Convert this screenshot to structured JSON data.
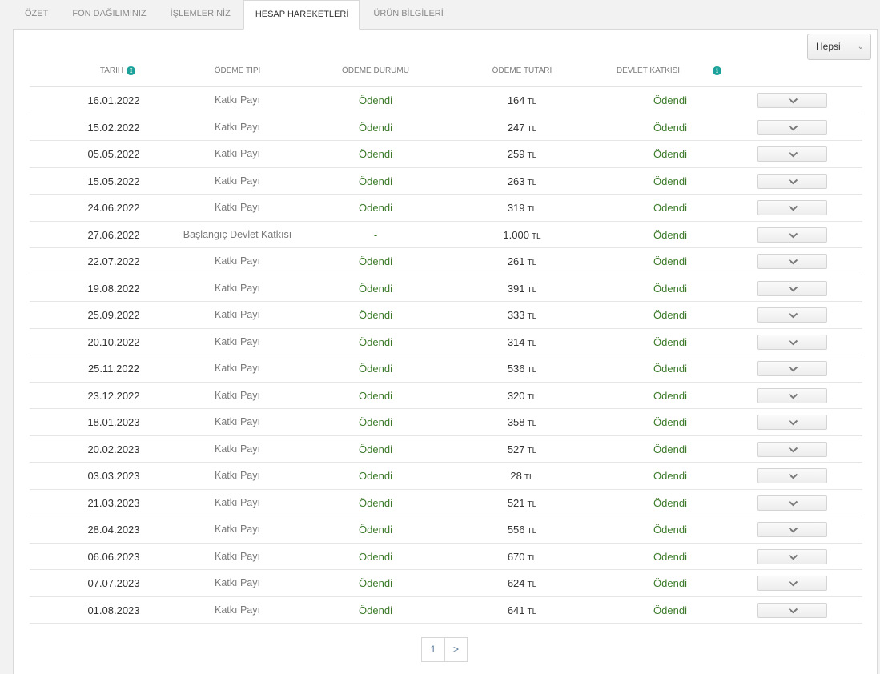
{
  "tabs": [
    {
      "label": "ÖZET"
    },
    {
      "label": "FON DAĞILIMINIZ"
    },
    {
      "label": "İŞLEMLERİNİZ"
    },
    {
      "label": "HESAP HAREKETLERİ",
      "active": true
    },
    {
      "label": "ÜRÜN BİLGİLERİ"
    }
  ],
  "filter": {
    "value": "Hepsi"
  },
  "columns": {
    "date": "TARİH",
    "type": "ÖDEME TİPİ",
    "status": "ÖDEME DURUMU",
    "amount": "ÖDEME TUTARI",
    "gov": "DEVLET KATKISI"
  },
  "currency": "TL",
  "rows": [
    {
      "date": "16.01.2022",
      "type": "Katkı Payı",
      "status": "Ödendi",
      "amount": "164",
      "gov": "Ödendi"
    },
    {
      "date": "15.02.2022",
      "type": "Katkı Payı",
      "status": "Ödendi",
      "amount": "247",
      "gov": "Ödendi"
    },
    {
      "date": "05.05.2022",
      "type": "Katkı Payı",
      "status": "Ödendi",
      "amount": "259",
      "gov": "Ödendi"
    },
    {
      "date": "15.05.2022",
      "type": "Katkı Payı",
      "status": "Ödendi",
      "amount": "263",
      "gov": "Ödendi"
    },
    {
      "date": "24.06.2022",
      "type": "Katkı Payı",
      "status": "Ödendi",
      "amount": "319",
      "gov": "Ödendi"
    },
    {
      "date": "27.06.2022",
      "type": "Başlangıç Devlet Katkısı",
      "status": "-",
      "amount": "1.000",
      "gov": "Ödendi"
    },
    {
      "date": "22.07.2022",
      "type": "Katkı Payı",
      "status": "Ödendi",
      "amount": "261",
      "gov": "Ödendi"
    },
    {
      "date": "19.08.2022",
      "type": "Katkı Payı",
      "status": "Ödendi",
      "amount": "391",
      "gov": "Ödendi"
    },
    {
      "date": "25.09.2022",
      "type": "Katkı Payı",
      "status": "Ödendi",
      "amount": "333",
      "gov": "Ödendi"
    },
    {
      "date": "20.10.2022",
      "type": "Katkı Payı",
      "status": "Ödendi",
      "amount": "314",
      "gov": "Ödendi"
    },
    {
      "date": "25.11.2022",
      "type": "Katkı Payı",
      "status": "Ödendi",
      "amount": "536",
      "gov": "Ödendi"
    },
    {
      "date": "23.12.2022",
      "type": "Katkı Payı",
      "status": "Ödendi",
      "amount": "320",
      "gov": "Ödendi"
    },
    {
      "date": "18.01.2023",
      "type": "Katkı Payı",
      "status": "Ödendi",
      "amount": "358",
      "gov": "Ödendi"
    },
    {
      "date": "20.02.2023",
      "type": "Katkı Payı",
      "status": "Ödendi",
      "amount": "527",
      "gov": "Ödendi"
    },
    {
      "date": "03.03.2023",
      "type": "Katkı Payı",
      "status": "Ödendi",
      "amount": "28",
      "gov": "Ödendi"
    },
    {
      "date": "21.03.2023",
      "type": "Katkı Payı",
      "status": "Ödendi",
      "amount": "521",
      "gov": "Ödendi"
    },
    {
      "date": "28.04.2023",
      "type": "Katkı Payı",
      "status": "Ödendi",
      "amount": "556",
      "gov": "Ödendi"
    },
    {
      "date": "06.06.2023",
      "type": "Katkı Payı",
      "status": "Ödendi",
      "amount": "670",
      "gov": "Ödendi"
    },
    {
      "date": "07.07.2023",
      "type": "Katkı Payı",
      "status": "Ödendi",
      "amount": "624",
      "gov": "Ödendi"
    },
    {
      "date": "01.08.2023",
      "type": "Katkı Payı",
      "status": "Ödendi",
      "amount": "641",
      "gov": "Ödendi"
    }
  ],
  "pagination": {
    "page": "1",
    "next": ">"
  },
  "colors": {
    "accent_teal": "#1aa29a",
    "status_green": "#3c7a2a"
  },
  "icons": {
    "info": "info-icon",
    "expand": "chevron-down-icon",
    "filter": "chevron-down-icon"
  }
}
